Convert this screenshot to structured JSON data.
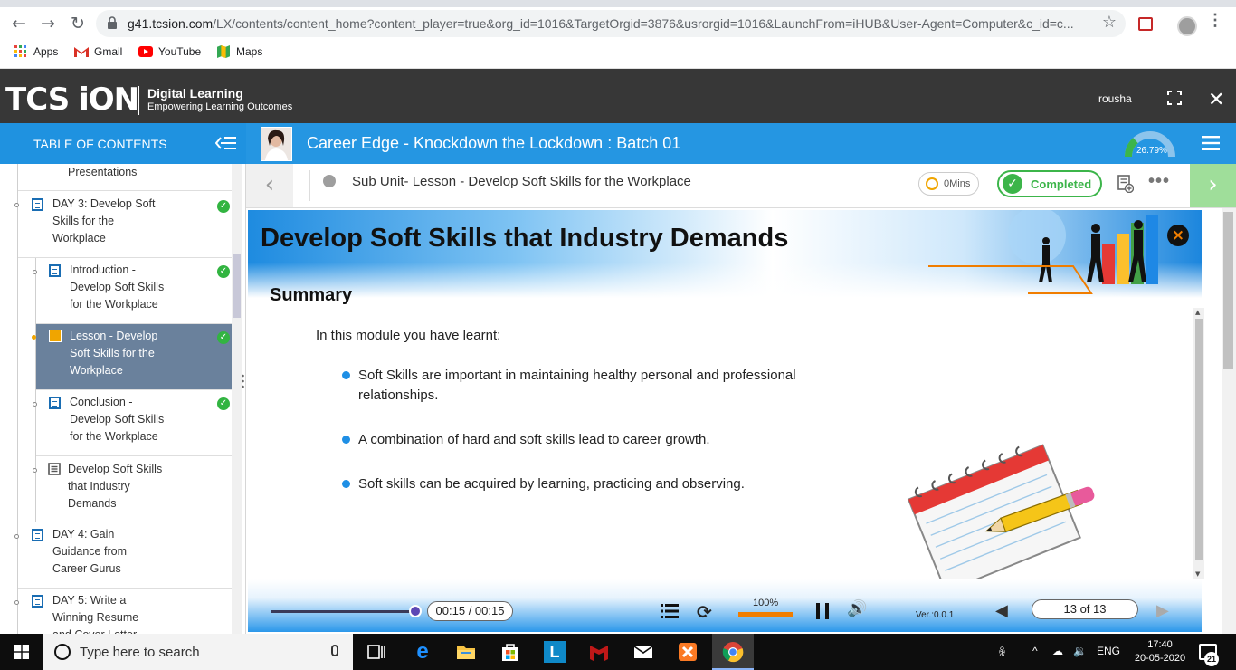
{
  "browser": {
    "url_host": "g41.tcsion.com",
    "url_path": "/LX/contents/content_home?content_player=true&org_id=1016&TargetOrgid=3876&usrorgid=1016&LaunchFrom=iHUB&User-Agent=Computer&c_id=c...",
    "bookmarks": [
      {
        "label": "Apps",
        "icon": "apps-grid-icon"
      },
      {
        "label": "Gmail",
        "icon": "gmail-icon"
      },
      {
        "label": "YouTube",
        "icon": "youtube-icon"
      },
      {
        "label": "Maps",
        "icon": "maps-icon"
      }
    ]
  },
  "header": {
    "brand": "TCS iON",
    "tagline_1": "Digital Learning",
    "tagline_2": "Empowering Learning Outcomes",
    "username": "rousha"
  },
  "toc": {
    "title": "TABLE OF CONTENTS",
    "items": [
      {
        "label": "Presentations"
      },
      {
        "label": "DAY 3: Develop Soft Skills for the Workplace",
        "done": true
      },
      {
        "label": "Introduction - Develop Soft Skills for the Workplace",
        "done": true
      },
      {
        "label": "Lesson - Develop Soft Skills for the Workplace",
        "done": true,
        "active": true
      },
      {
        "label": "Conclusion - Develop Soft Skills for the Workplace",
        "done": true
      },
      {
        "label": "Develop Soft Skills that Industry Demands"
      },
      {
        "label": "DAY 4: Gain Guidance from Career Gurus"
      },
      {
        "label": "DAY 5: Write a Winning Resume and Cover Letter"
      }
    ]
  },
  "course": {
    "title": "Career Edge - Knockdown the Lockdown : Batch 01",
    "progress_label": "26.79%",
    "progress_value": 26.79
  },
  "lesson": {
    "sub_unit": "Sub Unit- Lesson - Develop Soft Skills for the Workplace",
    "time_spent": "0Mins",
    "status": "Completed",
    "more": "•••"
  },
  "slide": {
    "title": "Develop Soft Skills that Industry Demands",
    "close": "×",
    "heading": "Summary",
    "intro": "In this module you have learnt:",
    "points": [
      "Soft Skills are important in maintaining healthy personal and professional relationships.",
      "A combination of hard and soft skills lead to career growth.",
      "Soft skills can be acquired by learning, practicing and observing."
    ]
  },
  "player": {
    "time": "00:15 / 00:15",
    "seek_fraction": 1.0,
    "speed": "100%",
    "version": "Ver.:0.0.1",
    "page": "13 of 13"
  },
  "taskbar": {
    "search_placeholder": "Type here to search",
    "language": "ENG",
    "time": "17:40",
    "date": "20-05-2020",
    "notifications": "21"
  },
  "colors": {
    "accent_blue": "#1f92e0",
    "header_dark": "#373737",
    "success_green": "#3cb54a",
    "active_item": "#6a819c",
    "orange": "#f07d00"
  }
}
